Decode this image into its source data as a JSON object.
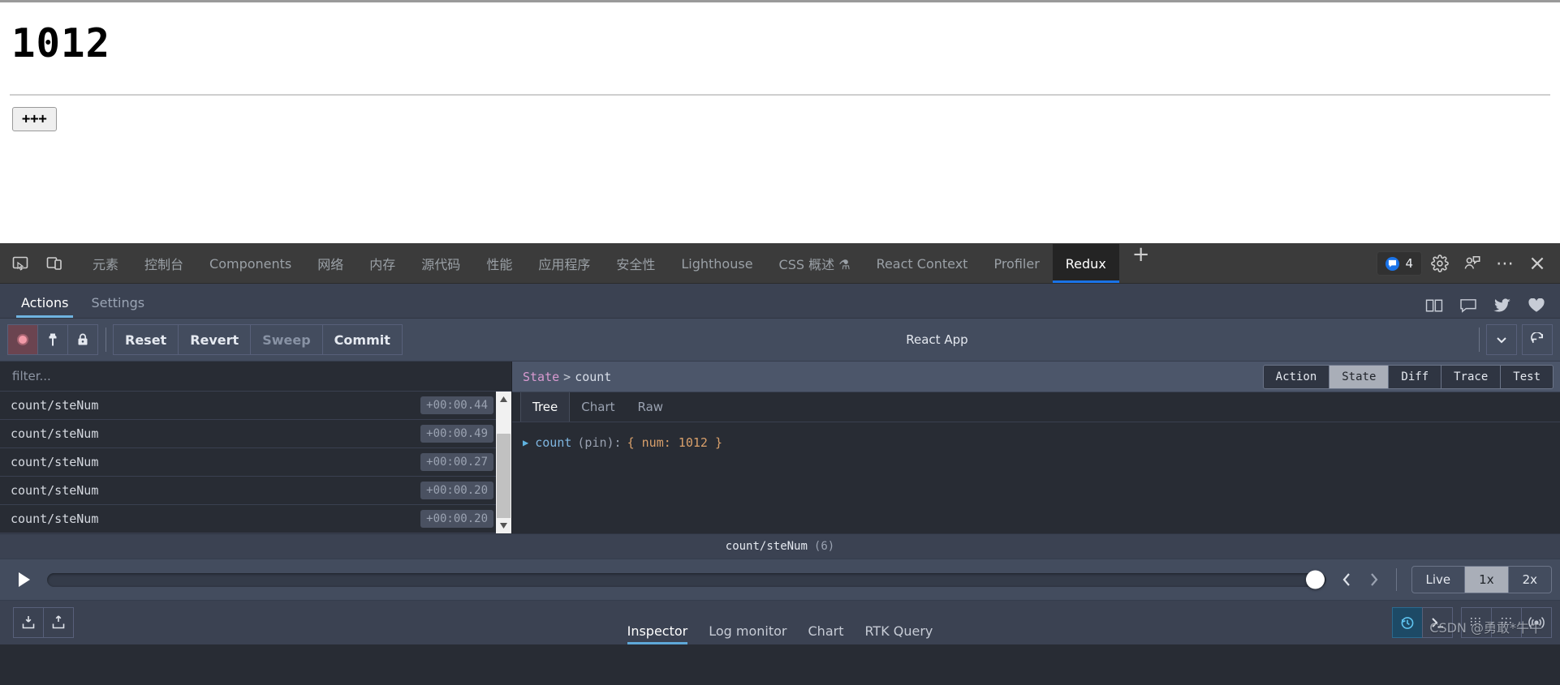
{
  "page": {
    "count_display": "1012",
    "increment_button": "+++"
  },
  "devtools": {
    "tabs": [
      {
        "label": "元素",
        "active": false
      },
      {
        "label": "控制台",
        "active": false
      },
      {
        "label": "Components",
        "active": false
      },
      {
        "label": "网络",
        "active": false
      },
      {
        "label": "内存",
        "active": false
      },
      {
        "label": "源代码",
        "active": false
      },
      {
        "label": "性能",
        "active": false
      },
      {
        "label": "应用程序",
        "active": false
      },
      {
        "label": "安全性",
        "active": false
      },
      {
        "label": "Lighthouse",
        "active": false
      },
      {
        "label": "CSS 概述 ⚗",
        "active": false
      },
      {
        "label": "React Context",
        "active": false
      },
      {
        "label": "Profiler",
        "active": false
      },
      {
        "label": "Redux",
        "active": true
      }
    ],
    "add_tab": "+",
    "message_count": "4",
    "more_label": "⋯",
    "close_label": "×",
    "accent_color": "#1a73e8"
  },
  "redux": {
    "subtabs": [
      {
        "label": "Actions",
        "active": true
      },
      {
        "label": "Settings",
        "active": false
      }
    ],
    "toolbar": {
      "reset": "Reset",
      "revert": "Revert",
      "sweep": "Sweep",
      "commit": "Commit",
      "instance": "React App"
    },
    "filter_placeholder": "filter...",
    "actions": [
      {
        "name": "count/steNum",
        "time": "+00:00.44"
      },
      {
        "name": "count/steNum",
        "time": "+00:00.49"
      },
      {
        "name": "count/steNum",
        "time": "+00:00.27"
      },
      {
        "name": "count/steNum",
        "time": "+00:00.20"
      },
      {
        "name": "count/steNum",
        "time": "+00:00.20"
      }
    ],
    "breadcrumb": {
      "root": "State",
      "sep": ">",
      "leaf": "count"
    },
    "state_tabs": [
      {
        "label": "Action",
        "active": false
      },
      {
        "label": "State",
        "active": true
      },
      {
        "label": "Diff",
        "active": false
      },
      {
        "label": "Trace",
        "active": false
      },
      {
        "label": "Test",
        "active": false
      }
    ],
    "view_tabs": [
      {
        "label": "Tree",
        "active": true
      },
      {
        "label": "Chart",
        "active": false
      },
      {
        "label": "Raw",
        "active": false
      }
    ],
    "tree": {
      "triangle": "▶",
      "key": "count",
      "pin": "(pin):",
      "value": "{ num: 1012 }"
    },
    "slider": {
      "label": "count/steNum",
      "count": "(6)",
      "prev": "‹",
      "next": "›",
      "speeds": [
        {
          "label": "Live",
          "active": false
        },
        {
          "label": "1x",
          "active": true
        },
        {
          "label": "2x",
          "active": false
        }
      ]
    },
    "monitor_tabs": [
      {
        "label": "Inspector",
        "active": true
      },
      {
        "label": "Log monitor",
        "active": false
      },
      {
        "label": "Chart",
        "active": false
      },
      {
        "label": "RTK Query",
        "active": false
      }
    ],
    "watermark": "CSDN @勇敢*牛牛"
  }
}
